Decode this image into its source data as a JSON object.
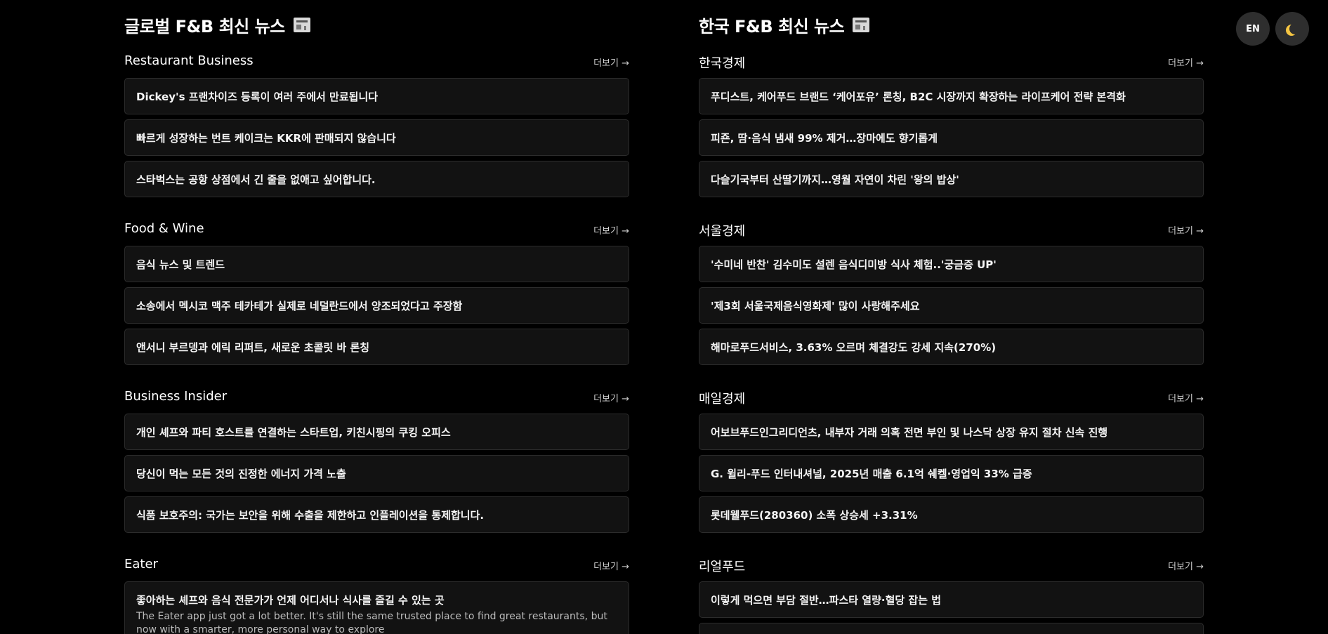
{
  "global": {
    "title": "글로벌 F&B 최신 뉴스",
    "sections": [
      {
        "name": "Restaurant Business",
        "more": "더보기 →",
        "items": [
          "Dickey's 프랜차이즈 등록이 여러 주에서 만료됩니다",
          "빠르게 성장하는 번트 케이크는 KKR에 판매되지 않습니다",
          "스타벅스는 공항 상점에서 긴 줄을 없애고 싶어합니다."
        ]
      },
      {
        "name": "Food & Wine",
        "more": "더보기 →",
        "items": [
          "음식 뉴스 및 트렌드",
          "소송에서 멕시코 맥주 테카테가 실제로 네덜란드에서 양조되었다고 주장함",
          "앤서니 부르뎅과 에릭 리퍼트, 새로운 초콜릿 바 론칭"
        ]
      },
      {
        "name": "Business Insider",
        "more": "더보기 →",
        "items": [
          "개인 셰프와 파티 호스트를 연결하는 스타트업, 키친시핑의 쿠킹 오피스",
          "당신이 먹는 모든 것의 진정한 에너지 가격 노출",
          "식품 보호주의: 국가는 보안을 위해 수출을 제한하고 인플레이션을 통제합니다."
        ]
      },
      {
        "name": "Eater",
        "more": "더보기 →",
        "items": [
          "좋아하는 셰프와 음식 전문가가 언제 어디서나 식사를 즐길 수 있는 곳"
        ],
        "first_item_desc": "The Eater app just got a lot better. It's still the same trusted place to find great restaurants, but now with a smarter, more personal way to explore"
      }
    ]
  },
  "korea": {
    "title": "한국 F&B 최신 뉴스",
    "sections": [
      {
        "name": "한국경제",
        "more": "더보기 →",
        "items": [
          "푸디스트, 케어푸드 브랜드 ‘케어포유’ 론칭, B2C 시장까지 확장하는 라이프케어 전략 본격화",
          "피죤, 땀·음식 냄새 99% 제거…장마에도 향기롭게",
          "다슬기국부터 산딸기까지…영월 자연이 차린 '왕의 밥상'"
        ]
      },
      {
        "name": "서울경제",
        "more": "더보기 →",
        "items": [
          "'수미네 반찬' 김수미도 설렌 음식디미방 식사 체험..'궁금증 UP'",
          "'제3회 서울국제음식영화제' 많이 사랑해주세요",
          "해마로푸드서비스, 3.63% 오르며 체결강도 강세 지속(270%)"
        ]
      },
      {
        "name": "매일경제",
        "more": "더보기 →",
        "items": [
          "어보브푸드인그리디언츠, 내부자 거래 의혹 전면 부인 및 나스닥 상장 유지 절차 신속 진행",
          "G. 윌리-푸드 인터내셔널, 2025년 매출 6.1억 쉐켈·영업익 33% 급증",
          "롯데웰푸드(280360) 소폭 상승세 +3.31%"
        ]
      },
      {
        "name": "리얼푸드",
        "more": "더보기 →",
        "items": [
          "이렇게 먹으면 부담 절반…파스타 열량·혈당 잡는 법"
        ]
      }
    ]
  },
  "controls": {
    "lang_label": "EN",
    "theme_icon": "moon-icon"
  }
}
